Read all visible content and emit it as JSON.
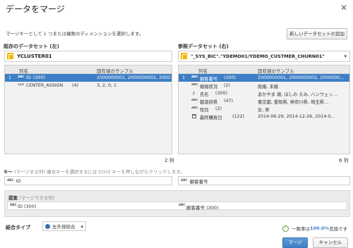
{
  "dialog": {
    "title": "データをマージ",
    "description": "マージキーとして 1 つまたは複数のディメンションを選択します。",
    "add_dataset_button": "新しいデータセットの追加"
  },
  "left": {
    "section_label": "既存のデータセット (左)",
    "dataset_name": "YCLUSTER01",
    "columns": {
      "name": "列名",
      "sample": "固有値のサンプル"
    },
    "rows": [
      {
        "num": "1",
        "type": "ABC",
        "name": "ID",
        "count": "(300)",
        "sample": "2000000001, 2000000002, 2000000…",
        "selected": true
      },
      {
        "num": "",
        "type": "123",
        "name": "CENTER_ASSIGN",
        "count": "(4)",
        "sample": "3, 2, 0, 1",
        "selected": false
      }
    ],
    "column_count": "2 列"
  },
  "right": {
    "section_label": "参照データセット (右)",
    "dataset_name": "\"_SYS_BIC\".\"YDEMO01/YDEMO_CUSTMER_CHURN01\"",
    "columns": {
      "name": "列名",
      "sample": "固有値のサンプル"
    },
    "rows": [
      {
        "num": "1",
        "type": "ABC",
        "name": "顧客番号",
        "count": "(300)",
        "sample": "2000000001, 2000000002, 2000000…",
        "selected": true
      },
      {
        "num": "",
        "type": "ABC",
        "name": "婚姻状況",
        "count": "(2)",
        "sample": "既婚, 未婚",
        "selected": false
      },
      {
        "num": "",
        "type": "key",
        "name": "氏名",
        "count": "(300)",
        "sample": "あかやま 敦, ほしの えみ, ハンウェッ…",
        "selected": false
      },
      {
        "num": "",
        "type": "ABC",
        "name": "都道府県",
        "count": "(47)",
        "sample": "東京都, 愛知県, 神奈川県, 埼玉県…",
        "selected": false
      },
      {
        "num": "",
        "type": "ABC",
        "name": "性別",
        "count": "(2)",
        "sample": "女, 男",
        "selected": false
      },
      {
        "num": "",
        "type": "cal",
        "name": "最終購買日",
        "count": "(122)",
        "sample": "2014-06-29, 2014-12-26, 2014-0…",
        "selected": false
      }
    ],
    "column_count": "6 列"
  },
  "keys": {
    "label": "キー",
    "hint": "(マージする列) 複合キーを選択するには [Ctrl] キーを押しながらクリックします。",
    "left_key": "ID",
    "right_key": "顧客番号"
  },
  "match": {
    "label": "提案",
    "hint": "(マージできる列)",
    "left": "ID (300)",
    "right": "顧客番号 (300)"
  },
  "join": {
    "label": "結合タイプ",
    "value": "左外部結合"
  },
  "status": {
    "prefix": "一致率は",
    "value": "100.0%",
    "suffix": "互換です"
  },
  "buttons": {
    "merge": "マージ",
    "cancel": "キャンセル"
  },
  "type_tags": {
    "abc": "ABC",
    "num": "123"
  },
  "colors": {
    "accent": "#3d7fc6",
    "dataset_icon": "#f0b800",
    "success": "#5aa02c"
  }
}
